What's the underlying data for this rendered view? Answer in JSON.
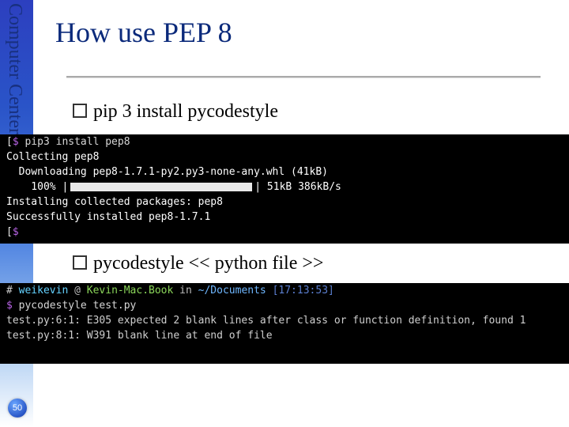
{
  "sidebar": {
    "label": "Computer Center, CS, NCTU"
  },
  "title": "How use PEP 8",
  "bullets": {
    "b1": "pip 3 install pycodestyle",
    "b2": "pycodestyle << python file >>"
  },
  "term1": {
    "l1_prefix": "[",
    "l1_dollar": "$",
    "l1_cmd": " pip3 install pep8",
    "l2": "Collecting pep8",
    "l3": "  Downloading pep8-1.7.1-py2.py3-none-any.whl (41kB)",
    "l4_pre": "    100% |",
    "l4_post": "| 51kB 386kB/s",
    "l5": "Installing collected packages: pep8",
    "l6": "Successfully installed pep8-1.7.1",
    "l7": "[",
    "l7_dollar": "$"
  },
  "term2": {
    "l1_hash": "# ",
    "l1_user": "weikevin",
    "l1_at": " @ ",
    "l1_host": "Kevin-Mac.Book",
    "l1_in": " in ",
    "l1_path": "~/Documents",
    "l1_time": " [17:13:53]",
    "l2_dollar": "$",
    "l2_cmd": " pycodestyle test.py",
    "l3": "test.py:6:1: E305 expected 2 blank lines after class or function definition, found 1",
    "l4": "test.py:8:1: W391 blank line at end of file"
  },
  "page": "50"
}
